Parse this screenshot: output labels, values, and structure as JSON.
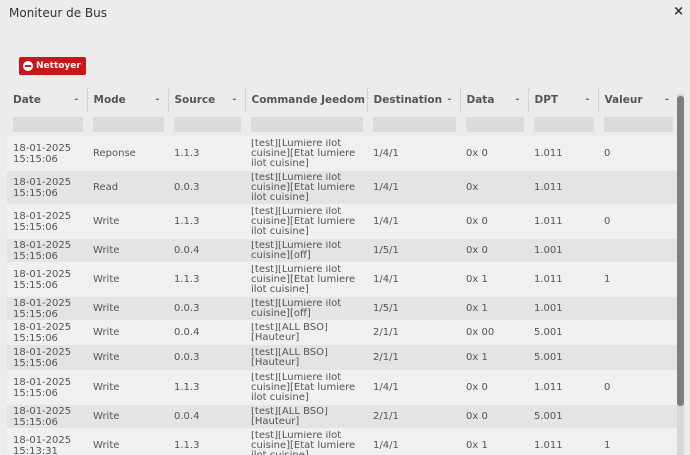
{
  "window": {
    "title": "Moniteur de Bus",
    "close_icon": "×"
  },
  "toolbar": {
    "clear_label": "Nettoyer",
    "clear_color": "#c7171b"
  },
  "table": {
    "columns": [
      {
        "label": "Date",
        "sort_icon": "-"
      },
      {
        "label": "Mode",
        "sort_icon": "-"
      },
      {
        "label": "Source",
        "sort_icon": "-"
      },
      {
        "label": "Commande Jeedom",
        "sort_icon": "-"
      },
      {
        "label": "Destination",
        "sort_icon": "-"
      },
      {
        "label": "Data",
        "sort_icon": "-"
      },
      {
        "label": "DPT",
        "sort_icon": "-"
      },
      {
        "label": "Valeur",
        "sort_icon": "-"
      }
    ],
    "rows": [
      {
        "date": "18-01-2025 15:15:06",
        "mode": "Reponse",
        "source": "1.1.3",
        "commande": "[test][Lumiere ilot cuisine][Etat lumiere ilot cuisine]",
        "destination": "1/4/1",
        "data": "0x 0",
        "dpt": "1.011",
        "valeur": "0"
      },
      {
        "date": "18-01-2025 15:15:06",
        "mode": "Read",
        "source": "0.0.3",
        "commande": "[test][Lumiere ilot cuisine][Etat lumiere ilot cuisine]",
        "destination": "1/4/1",
        "data": "0x",
        "dpt": "1.011",
        "valeur": ""
      },
      {
        "date": "18-01-2025 15:15:06",
        "mode": "Write",
        "source": "1.1.3",
        "commande": "[test][Lumiere ilot cuisine][Etat lumiere ilot cuisine]",
        "destination": "1/4/1",
        "data": "0x 0",
        "dpt": "1.011",
        "valeur": "0"
      },
      {
        "date": "18-01-2025 15:15:06",
        "mode": "Write",
        "source": "0.0.4",
        "commande": "[test][Lumiere ilot cuisine][off]",
        "destination": "1/5/1",
        "data": "0x 0",
        "dpt": "1.001",
        "valeur": ""
      },
      {
        "date": "18-01-2025 15:15:06",
        "mode": "Write",
        "source": "1.1.3",
        "commande": "[test][Lumiere ilot cuisine][Etat lumiere ilot cuisine]",
        "destination": "1/4/1",
        "data": "0x 1",
        "dpt": "1.011",
        "valeur": "1"
      },
      {
        "date": "18-01-2025 15:15:06",
        "mode": "Write",
        "source": "0.0.3",
        "commande": "[test][Lumiere ilot cuisine][off]",
        "destination": "1/5/1",
        "data": "0x 1",
        "dpt": "1.001",
        "valeur": ""
      },
      {
        "date": "18-01-2025 15:15:06",
        "mode": "Write",
        "source": "0.0.4",
        "commande": "[test][ALL BSO][Hauteur]",
        "destination": "2/1/1",
        "data": "0x 00",
        "dpt": "5.001",
        "valeur": ""
      },
      {
        "date": "18-01-2025 15:15:06",
        "mode": "Write",
        "source": "0.0.3",
        "commande": "[test][ALL BSO][Hauteur]",
        "destination": "2/1/1",
        "data": "0x 1",
        "dpt": "5.001",
        "valeur": ""
      },
      {
        "date": "18-01-2025 15:15:06",
        "mode": "Write",
        "source": "1.1.3",
        "commande": "[test][Lumiere ilot cuisine][Etat lumiere ilot cuisine]",
        "destination": "1/4/1",
        "data": "0x 0",
        "dpt": "1.011",
        "valeur": "0"
      },
      {
        "date": "18-01-2025 15:15:06",
        "mode": "Write",
        "source": "0.0.4",
        "commande": "[test][ALL BSO][Hauteur]",
        "destination": "2/1/1",
        "data": "0x 0",
        "dpt": "5.001",
        "valeur": ""
      },
      {
        "date": "18-01-2025 15:13:31",
        "mode": "Write",
        "source": "1.1.3",
        "commande": "[test][Lumiere ilot cuisine][Etat lumiere ilot cuisine]",
        "destination": "1/4/1",
        "data": "0x 1",
        "dpt": "1.011",
        "valeur": "1"
      }
    ]
  }
}
